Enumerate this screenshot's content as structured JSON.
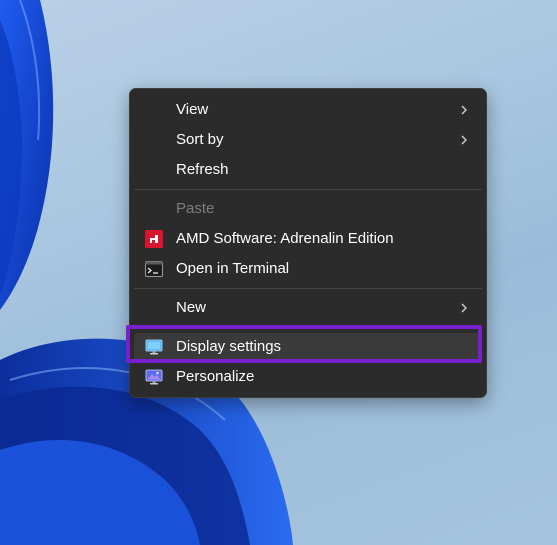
{
  "context_menu": {
    "items": [
      {
        "label": "View",
        "has_submenu": true
      },
      {
        "label": "Sort by",
        "has_submenu": true
      },
      {
        "label": "Refresh",
        "has_submenu": false
      },
      {
        "label": "Paste",
        "has_submenu": false,
        "disabled": true
      },
      {
        "label": "AMD Software: Adrenalin Edition",
        "icon": "amd-icon"
      },
      {
        "label": "Open in Terminal",
        "icon": "terminal-icon"
      },
      {
        "label": "New",
        "has_submenu": true
      },
      {
        "label": "Display settings",
        "icon": "display-icon",
        "highlighted": true
      },
      {
        "label": "Personalize",
        "icon": "personalize-icon"
      }
    ]
  },
  "colors": {
    "menu_background": "#2b2b2b",
    "highlight_outline": "#7a1fd0",
    "amd_red": "#d8142f",
    "wallpaper_blue": "#1a4fd6"
  }
}
